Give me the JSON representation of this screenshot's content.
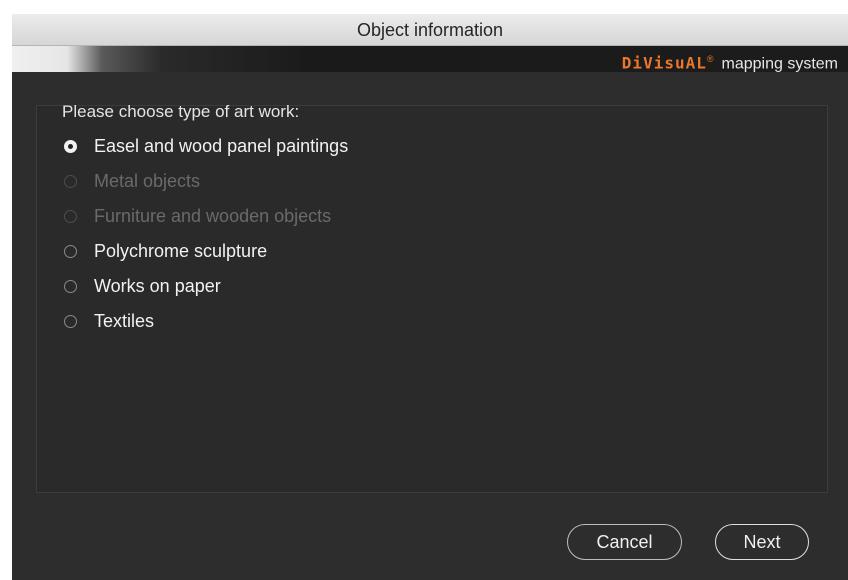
{
  "window": {
    "title": "Object information",
    "brand": {
      "name": "DiVisuAL",
      "reg": "®",
      "tagline": "mapping system"
    }
  },
  "form": {
    "prompt": "Please choose type of art work:",
    "options": [
      {
        "label": "Easel and wood panel paintings",
        "checked": true,
        "enabled": true
      },
      {
        "label": "Metal objects",
        "checked": false,
        "enabled": false
      },
      {
        "label": "Furniture and wooden objects",
        "checked": false,
        "enabled": false
      },
      {
        "label": "Polychrome sculpture",
        "checked": false,
        "enabled": true
      },
      {
        "label": "Works on paper",
        "checked": false,
        "enabled": true
      },
      {
        "label": "Textiles",
        "checked": false,
        "enabled": true
      }
    ]
  },
  "buttons": {
    "cancel": "Cancel",
    "next": "Next"
  },
  "colors": {
    "brand_accent": "#e8782c",
    "background": "#2d2d2d",
    "text": "#f2f2f2",
    "disabled_text": "#6a6a6a"
  }
}
